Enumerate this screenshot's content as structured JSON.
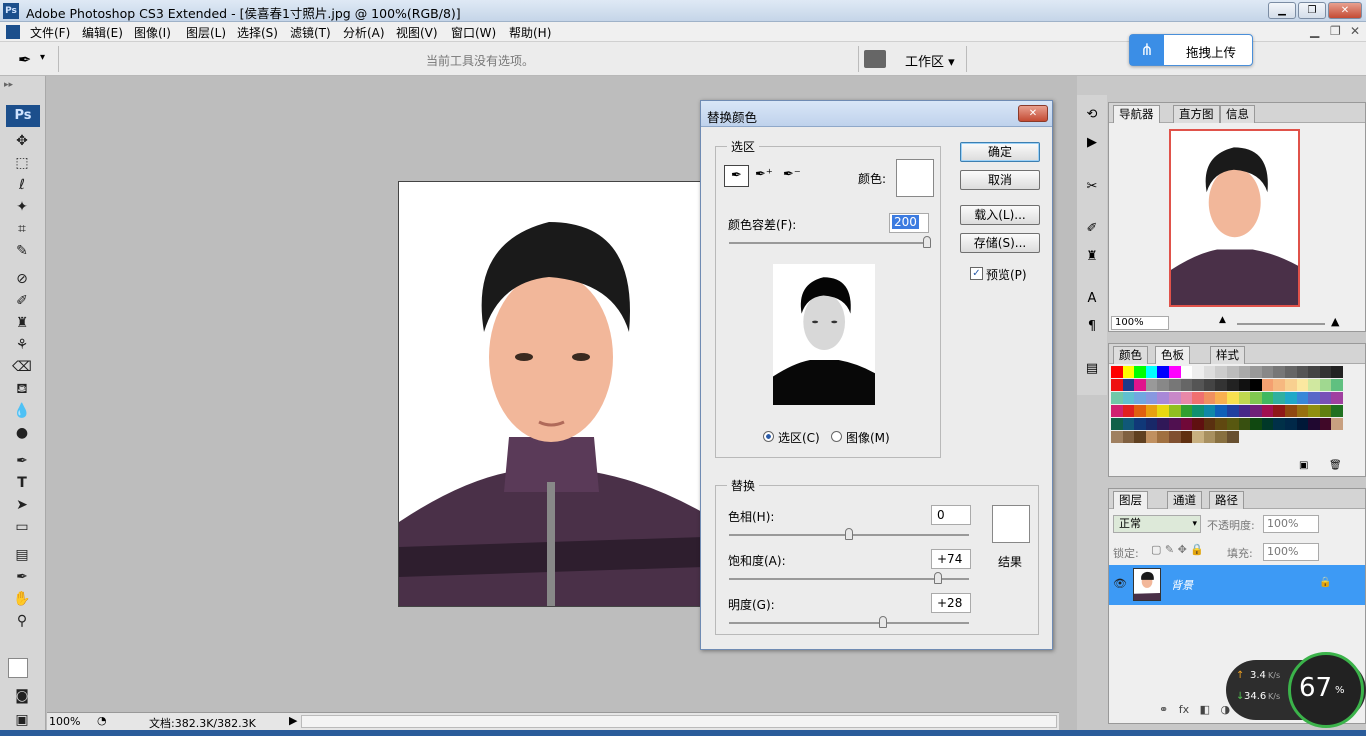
{
  "window": {
    "app_icon": "Ps",
    "title": "Adobe Photoshop CS3 Extended - [侯喜春1寸照片.jpg @ 100%(RGB/8)]"
  },
  "menu": [
    "文件(F)",
    "编辑(E)",
    "图像(I)",
    "图层(L)",
    "选择(S)",
    "滤镜(T)",
    "分析(A)",
    "视图(V)",
    "窗口(W)",
    "帮助(H)"
  ],
  "options_bar": {
    "hint": "当前工具没有选项。",
    "workspace": "工作区 ▾"
  },
  "upload_button": "拖拽上传",
  "status": {
    "zoom": "100%",
    "doc_info": "文档:382.3K/382.3K"
  },
  "panels": {
    "navigator": {
      "tabs": [
        "导航器",
        "直方图",
        "信息"
      ],
      "zoom": "100%"
    },
    "swatches": {
      "tabs": [
        "颜色",
        "色板",
        "样式"
      ]
    },
    "layers": {
      "tabs": [
        "图层",
        "通道",
        "路径"
      ],
      "blend_mode": "正常",
      "opacity_label": "不透明度:",
      "opacity": "100%",
      "lock_label": "锁定:",
      "fill_label": "填充:",
      "fill": "100%",
      "layer_name": "背景"
    }
  },
  "dialog": {
    "title": "替换颜色",
    "selection_group": "选区",
    "color_label": "颜色:",
    "tolerance_label": "颜色容差(F):",
    "tolerance_value": "200",
    "radio_selection": "选区(C)",
    "radio_image": "图像(M)",
    "replace_group": "替换",
    "hue_label": "色相(H):",
    "hue_value": "0",
    "hue_level": 0.5,
    "saturation_label": "饱和度(A):",
    "saturation_value": "+74",
    "saturation_level": 0.87,
    "lightness_label": "明度(G):",
    "lightness_value": "+28",
    "lightness_level": 0.64,
    "result_label": "结果",
    "ok": "确定",
    "cancel": "取消",
    "load": "载入(L)...",
    "save": "存储(S)...",
    "preview": "预览(P)"
  },
  "net_widget": {
    "up": "3.4",
    "down": "34.6",
    "unit": "K/s",
    "cpu": "67",
    "pct": "%"
  }
}
